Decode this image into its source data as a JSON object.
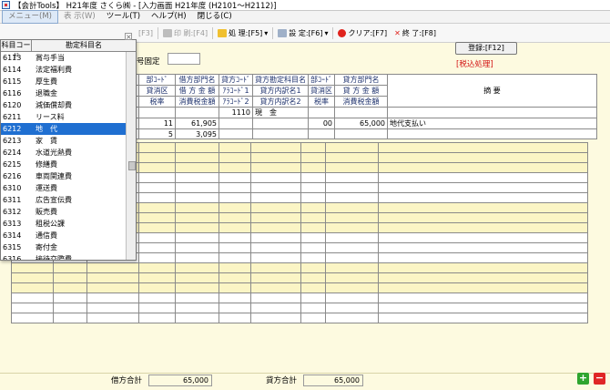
{
  "window": {
    "title": "【会計Tools】 H21年度 さくら㈱ - [入力画面 H21年度 (H2101～H2112)]"
  },
  "menu": [
    {
      "label": "メニュー(M)"
    },
    {
      "label": "表 示(W)"
    },
    {
      "label": "ツール(T)"
    },
    {
      "label": "ヘルプ(H)"
    },
    {
      "label": "閉じる(C)"
    }
  ],
  "toolbar": {
    "btn1": "[F3]",
    "btn2": "印 刷:[F4]",
    "btn3": "処 理:[F5]",
    "btn4": "設 定:[F6]",
    "btn5": "クリア:[F7]",
    "btn6": "終 了:[F8]"
  },
  "header": {
    "upper_label": "号固定",
    "upper_value": "",
    "register_button": "登録:[F12]",
    "tax_link": "[税込処理]"
  },
  "grid": {
    "headers": {
      "h1": "部ｺｰﾄﾞ",
      "h2": "借方部門名",
      "h3": "貸方ｺｰﾄﾞ",
      "h4": "貸方勘定科目名",
      "h5": "部ｺｰﾄﾞ",
      "h6": "貸方部門名",
      "h7": "摘 要",
      "h8": "貸消区",
      "h9": "借 方 金 額",
      "h10": "ｱﾗｺｰﾄﾞ1",
      "h11": "貸方内訳名1",
      "h12": "貸消区",
      "h13": "貸 方 金 額",
      "h14": "税率",
      "h15": "消費税金額",
      "h16": "ｱﾗｺｰﾄﾞ2",
      "h17": "貸方内訳名2",
      "h18": "税率",
      "h19": "消費税金額"
    },
    "entry": {
      "credit_code": "1110",
      "credit_name": "現　金",
      "row1_code": "11",
      "row1_debit_amount": "61,905",
      "row1_credit_dept": "00",
      "row1_credit_amount": "65,000",
      "row1_memo": "地代支払い",
      "row2_code": "5",
      "row2_tax_amount": "3,095"
    }
  },
  "dropdown": {
    "col_code": "科目コード",
    "col_name": "勘定科目名",
    "close_label": "×",
    "items": [
      {
        "code": "6113",
        "name": "賞与手当"
      },
      {
        "code": "6114",
        "name": "法定福利費"
      },
      {
        "code": "6115",
        "name": "厚生費"
      },
      {
        "code": "6116",
        "name": "退職金"
      },
      {
        "code": "6120",
        "name": "減価償却費"
      },
      {
        "code": "6211",
        "name": "リース料"
      },
      {
        "code": "6212",
        "name": "地　代"
      },
      {
        "code": "6213",
        "name": "家　賃"
      },
      {
        "code": "6214",
        "name": "水道光熱費"
      },
      {
        "code": "6215",
        "name": "修繕費"
      },
      {
        "code": "6216",
        "name": "車両関連費"
      },
      {
        "code": "6310",
        "name": "運送費"
      },
      {
        "code": "6311",
        "name": "広告宣伝費"
      },
      {
        "code": "6312",
        "name": "販売費"
      },
      {
        "code": "6313",
        "name": "租税公課"
      },
      {
        "code": "6314",
        "name": "通信費"
      },
      {
        "code": "6315",
        "name": "寄付金"
      },
      {
        "code": "6316",
        "name": "接待交際費"
      }
    ],
    "selected_index": 6
  },
  "totals": {
    "debit_label": "借方合計",
    "debit_value": "65,000",
    "credit_label": "貸方合計",
    "credit_value": "65,000"
  },
  "buttons": {
    "add": "+",
    "delete": "−"
  }
}
